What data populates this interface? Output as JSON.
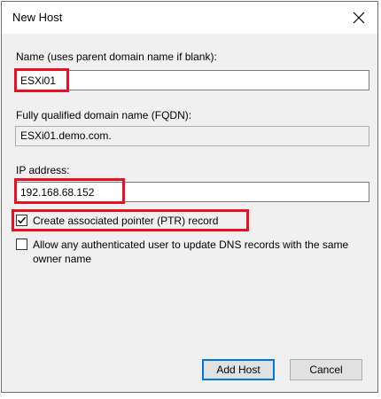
{
  "window": {
    "title": "New Host"
  },
  "name": {
    "label": "Name (uses parent domain name if blank):",
    "value": "ESXi01"
  },
  "fqdn": {
    "label": "Fully qualified domain name (FQDN):",
    "value": "ESXi01.demo.com."
  },
  "ip": {
    "label": "IP address:",
    "value": "192.168.68.152"
  },
  "ptr": {
    "label": "Create associated pointer (PTR) record",
    "checked": true
  },
  "allow_update": {
    "label": "Allow any authenticated user to update DNS records with the same owner name",
    "checked": false
  },
  "buttons": {
    "add_host": "Add Host",
    "cancel": "Cancel"
  },
  "colors": {
    "highlight": "#e81123",
    "accent": "#0078d7"
  }
}
